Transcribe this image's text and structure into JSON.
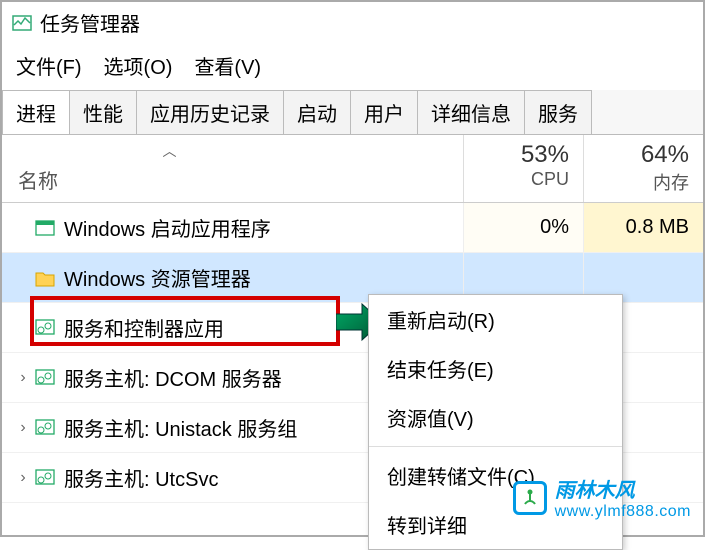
{
  "window": {
    "title": "任务管理器"
  },
  "menubar": {
    "file": "文件(F)",
    "options": "选项(O)",
    "view": "查看(V)"
  },
  "tabs": {
    "processes": "进程",
    "performance": "性能",
    "app_history": "应用历史记录",
    "startup": "启动",
    "users": "用户",
    "details": "详细信息",
    "services": "服务"
  },
  "columns": {
    "name": "名称",
    "cpu_pct": "53%",
    "cpu_label": "CPU",
    "mem_pct": "64%",
    "mem_label": "内存"
  },
  "rows": [
    {
      "name": "Windows 启动应用程序",
      "cpu": "0%",
      "mem": "0.8 MB",
      "expandable": false
    },
    {
      "name": "Windows 资源管理器",
      "cpu": "",
      "mem": "",
      "expandable": false
    },
    {
      "name": "服务和控制器应用",
      "cpu": "",
      "mem": "",
      "expandable": false
    },
    {
      "name": "服务主机: DCOM 服务器",
      "cpu": "",
      "mem": "",
      "expandable": true
    },
    {
      "name": "服务主机: Unistack 服务组",
      "cpu": "",
      "mem": "",
      "expandable": true
    },
    {
      "name": "服务主机: UtcSvc",
      "cpu": "",
      "mem": "",
      "expandable": true
    }
  ],
  "context_menu": {
    "restart": "重新启动(R)",
    "end_task": "结束任务(E)",
    "resource_values": "资源值(V)",
    "create_dump": "创建转储文件(C)",
    "go_to_details": "转到详细"
  },
  "watermark": {
    "name_cn": "雨林木风",
    "url": "www.ylmf888.com"
  }
}
